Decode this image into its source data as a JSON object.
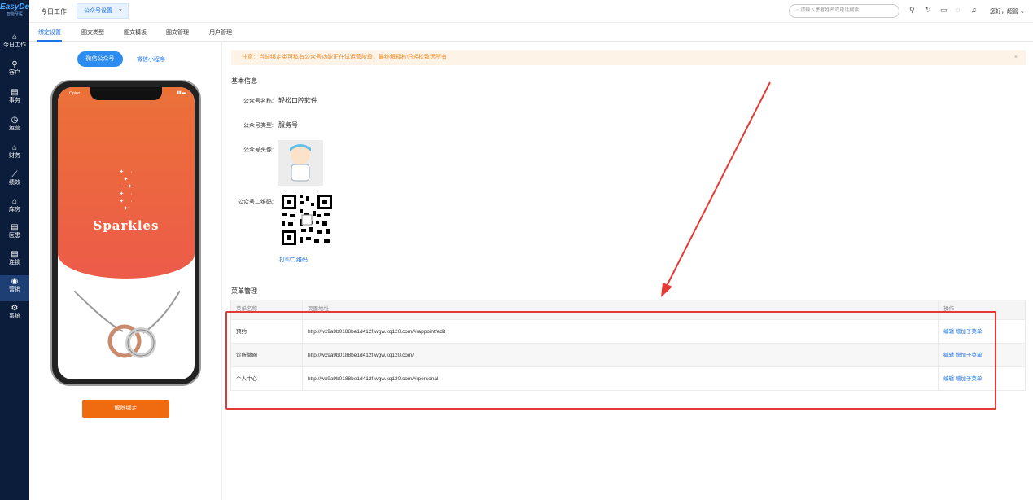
{
  "logo": {
    "brand": "EasyDent",
    "sub": "智能牙医"
  },
  "sidebar": {
    "items": [
      {
        "label": "今日工作",
        "icon": "home-icon"
      },
      {
        "label": "客户",
        "icon": "user-icon"
      },
      {
        "label": "事务",
        "icon": "doc-icon"
      },
      {
        "label": "运营",
        "icon": "clock-icon"
      },
      {
        "label": "财务",
        "icon": "finance-icon"
      },
      {
        "label": "绩效",
        "icon": "chart-icon"
      },
      {
        "label": "库房",
        "icon": "warehouse-icon"
      },
      {
        "label": "医患",
        "icon": "doc-icon"
      },
      {
        "label": "连锁",
        "icon": "doc-icon"
      },
      {
        "label": "营销",
        "icon": "marketing-icon"
      },
      {
        "label": "系统",
        "icon": "gear-icon"
      }
    ]
  },
  "topbar": {
    "today": "今日工作",
    "active_tab": "公众号设置",
    "close": "×",
    "search_placeholder": "请输入患者姓名或电话搜索",
    "greeting": "您好，超管"
  },
  "subnav": [
    "绑定设置",
    "图文类型",
    "图文模板",
    "图文管理",
    "用户管理"
  ],
  "left": {
    "wx_btn": "微信公众号",
    "mini_btn": "微信小程序",
    "phone": {
      "carrier": "Optus",
      "brand": "Sparkles"
    },
    "unbind": "解除绑定"
  },
  "notice": {
    "text": "注意：当前绑定类可私有公众号功能正在试运营阶段，最终解释权归轻松致远所有",
    "close": "×"
  },
  "basic": {
    "title": "基本信息",
    "name_label": "公众号名称:",
    "name": "轻松口腔软件",
    "type_label": "公众号类型:",
    "type": "服务号",
    "avatar_label": "公众号头像:",
    "qr_label": "公众号二维码:",
    "print_qr": "打印二维码"
  },
  "menu": {
    "title": "菜单管理",
    "headers": [
      "菜单名称",
      "页面地址",
      "操作"
    ],
    "rows": [
      {
        "name": "预约",
        "url": "http://wx9a9b0188be1d412f.wgw.kq120.com/#/appoint/edit",
        "edit": "编辑",
        "add": "增加子菜单"
      },
      {
        "name": "诊所微网",
        "url": "http://wx9a9b0188be1d412f.wgw.kq120.com/",
        "edit": "编辑",
        "add": "增加子菜单"
      },
      {
        "name": "个人中心",
        "url": "http://wx9a9b0188be1d412f.wgw.kq120.com/#/personal",
        "edit": "编辑",
        "add": "增加子菜单"
      }
    ]
  },
  "colors": {
    "sidebar": "#0b1d3a",
    "accent": "#1a73e8",
    "unbind": "#f06a0f",
    "annotation": "#e53935"
  }
}
